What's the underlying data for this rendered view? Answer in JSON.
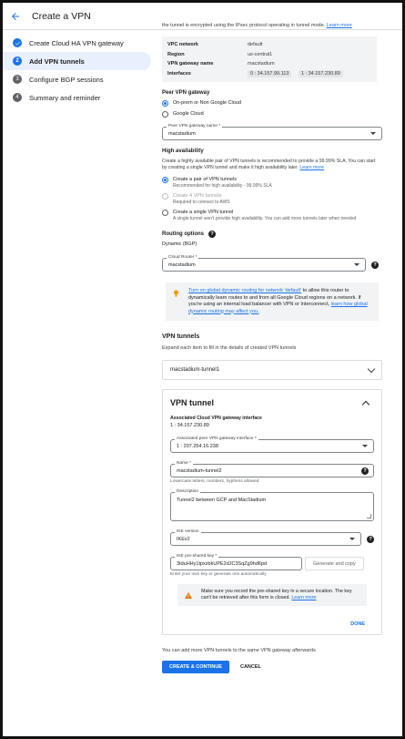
{
  "header": {
    "title": "Create a VPN"
  },
  "steps": [
    {
      "num": "✓",
      "label": "Create Cloud HA VPN gateway"
    },
    {
      "num": "2",
      "label": "Add VPN tunnels"
    },
    {
      "num": "3",
      "label": "Configure BGP sessions"
    },
    {
      "num": "4",
      "label": "Summary and reminder"
    }
  ],
  "intro": {
    "text": "the tunnel is encrypted using the IPsec protocol operating in tunnel mode.",
    "link": "Learn more"
  },
  "info": {
    "vpc_key": "VPC network",
    "vpc_val": "default",
    "region_key": "Region",
    "region_val": "us-central1",
    "gw_key": "VPN gateway name",
    "gw_val": "macstadium",
    "iface_key": "Interfaces",
    "iface0": "0 : 34.157.99.113",
    "iface1": "1 : 34.157.230.89"
  },
  "peer": {
    "title": "Peer VPN gateway",
    "opt1": "On-prem or Non Google Cloud",
    "opt2": "Google Cloud",
    "field_label": "Peer VPN gateway name *",
    "field_value": "macstadium"
  },
  "ha": {
    "title": "High availability",
    "desc": "Create a highly available pair of VPN tunnels is recommended to provide a 99.99% SLA. You can start by creating a single VPN tunnel and make it high availability later.",
    "link": "Learn more",
    "opt1": "Create a pair of VPN tunnels",
    "opt1_sub": "Recommended for high availability - 99.99% SLA",
    "opt2": "Create 4 VPN tunnels",
    "opt2_sub": "Required to connect to AWS",
    "opt3": "Create a single VPN tunnel",
    "opt3_sub": "A single tunnel won't provide high availability. You can add more tunnels later when needed"
  },
  "routing": {
    "title": "Routing options",
    "value": "Dynamic (BGP)",
    "router_label": "Cloud Router *",
    "router_value": "macstadium"
  },
  "infobox": {
    "link1": "Turn on global dynamic routing for network 'default'",
    "text1": " to allow this router to dynamically learn routes to and from all Google Cloud regions on a network. If you're using an internal load balancer with VPN or Interconnect, ",
    "link2": "learn how global dynamic routing may affect you."
  },
  "tunnels": {
    "title": "VPN tunnels",
    "desc": "Expand each item to fill in the details of created VPN tunnels",
    "collapsed_name": "macstadium-tunnel1"
  },
  "panel": {
    "title": "VPN tunnel",
    "assoc_label": "Associated Cloud VPN gateway interface",
    "assoc_value": "1 : 34.157.230.89",
    "peer_iface_label": "Associated peer VPN gateway interface *",
    "peer_iface_value": "1 : 207.254.16.238",
    "name_label": "Name *",
    "name_value": "macstadium-tunnel2",
    "name_hint": "Lowercase letters, numbers, hyphens allowed",
    "desc_label": "Description",
    "desc_value": "Tunnel2 between GCP and MacStadium",
    "ike_label": "IKE version",
    "ike_value": "IKEv2",
    "psk_label": "IKE pre-shared key *",
    "psk_value": "3tduHHy1tpxzbkUPE2dJC3SqZg9hd6pd",
    "generate": "Generate and copy",
    "psk_hint": "Enter your own key or generate one automatically",
    "warn_text": "Make sure you record the pre-shared key in a secure location. The key can't be retrieved after this form is closed.",
    "warn_link": "Learn more",
    "done": "DONE"
  },
  "footer": {
    "note": "You can add more VPN tunnels to the same VPN gateway afterwards",
    "create": "CREATE & CONTINUE",
    "cancel": "CANCEL"
  },
  "colors": {
    "accent": "#1a73e8",
    "warning": "#f29900",
    "panel_bg": "#f1f3f4"
  }
}
